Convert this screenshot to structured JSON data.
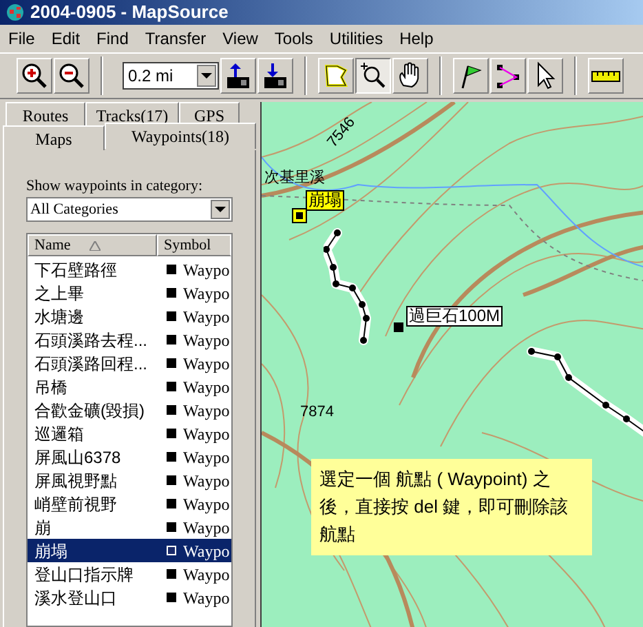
{
  "window": {
    "title": "2004-0905 - MapSource"
  },
  "menu": [
    "File",
    "Edit",
    "Find",
    "Transfer",
    "View",
    "Tools",
    "Utilities",
    "Help"
  ],
  "toolbar": {
    "scale": "0.2 mi",
    "tools": [
      {
        "kind": "zoom-in",
        "selected": false
      },
      {
        "kind": "zoom-out",
        "selected": false
      },
      {
        "kind": "scale"
      },
      {
        "kind": "upload",
        "selected": false
      },
      {
        "kind": "download",
        "selected": false
      },
      {
        "kind": "area",
        "selected": false
      },
      {
        "kind": "zoom",
        "selected": true
      },
      {
        "kind": "hand",
        "selected": false
      },
      {
        "kind": "flag",
        "selected": false
      },
      {
        "kind": "route",
        "selected": false
      },
      {
        "kind": "pointer",
        "selected": false
      },
      {
        "kind": "ruler",
        "selected": false
      }
    ]
  },
  "tabs": [
    [
      {
        "label": "Routes",
        "selected": false
      },
      {
        "label": "Tracks(17)",
        "selected": false
      },
      {
        "label": "GPS",
        "selected": false
      }
    ],
    [
      {
        "label": "Maps",
        "selected": false
      },
      {
        "label": "Waypoints(18)",
        "selected": true
      }
    ]
  ],
  "category": {
    "label": "Show waypoints in category:",
    "value": "All Categories"
  },
  "table": {
    "columns": [
      "Name",
      "Symbol"
    ],
    "rows": [
      {
        "name": "下石壁路徑",
        "symbol": "Waypo",
        "selected": false
      },
      {
        "name": "之上畢",
        "symbol": "Waypo",
        "selected": false
      },
      {
        "name": "水塘邊",
        "symbol": "Waypo",
        "selected": false
      },
      {
        "name": "石頭溪路去程...",
        "symbol": "Waypo",
        "selected": false
      },
      {
        "name": "石頭溪路回程...",
        "symbol": "Waypo",
        "selected": false
      },
      {
        "name": "吊橋",
        "symbol": "Waypo",
        "selected": false
      },
      {
        "name": "合歡金礦(毀損)",
        "symbol": "Waypo",
        "selected": false
      },
      {
        "name": "巡邏箱",
        "symbol": "Waypo",
        "selected": false
      },
      {
        "name": "屏風山6378",
        "symbol": "Waypo",
        "selected": false
      },
      {
        "name": "屏風視野點",
        "symbol": "Waypo",
        "selected": false
      },
      {
        "name": "峭壁前視野",
        "symbol": "Waypo",
        "selected": false
      },
      {
        "name": "崩",
        "symbol": "Waypo",
        "selected": false
      },
      {
        "name": "崩塌",
        "symbol": "Waypo",
        "selected": true
      },
      {
        "name": "登山口指示牌",
        "symbol": "Waypo",
        "selected": false
      },
      {
        "name": "溪水登山口",
        "symbol": "Waypo",
        "selected": false
      }
    ]
  },
  "map": {
    "contour_labels": [
      "7546",
      "7874"
    ],
    "place_label": "次基里溪",
    "waypoints": [
      {
        "name": "崩塌",
        "selected": true
      },
      {
        "name": "過巨石100M",
        "selected": false
      }
    ],
    "note": "選定一個 航點 ( Waypoint) 之後，直接按 del 鍵，即可刪除該航點"
  }
}
